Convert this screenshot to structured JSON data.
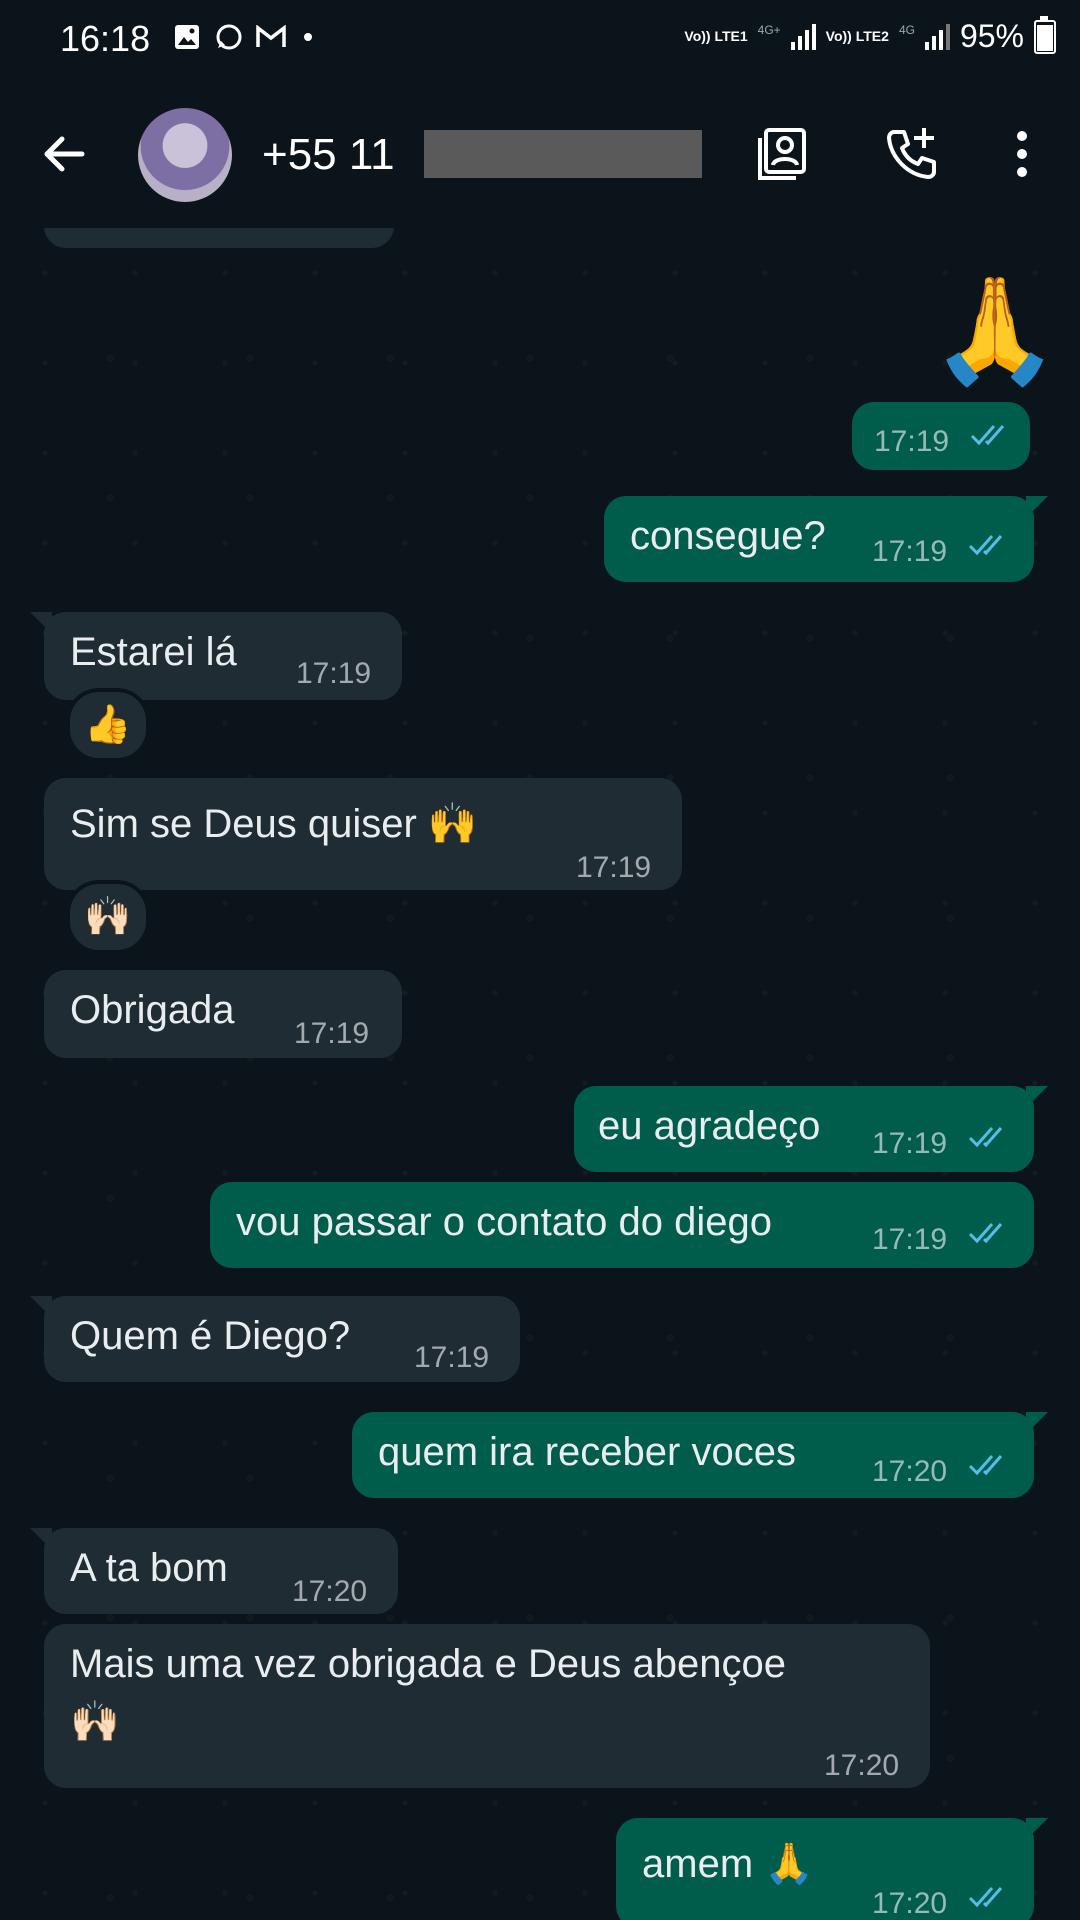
{
  "status_bar": {
    "time": "16:18",
    "sim1_label": "Vo)) LTE1",
    "sim1_net": "4G+",
    "sim2_label": "Vo)) LTE2",
    "sim2_net": "4G",
    "battery": "95%"
  },
  "header": {
    "contact_visible": "+55 11",
    "icons": [
      "back-arrow-icon",
      "contact-card-icon",
      "add-call-icon",
      "more-vertical-icon"
    ]
  },
  "messages": [
    {
      "dir": "out",
      "emoji": "🙏",
      "time": "17:19",
      "status": "read"
    },
    {
      "dir": "out",
      "text": "consegue?",
      "time": "17:19",
      "status": "read"
    },
    {
      "dir": "in",
      "text": "Estarei lá",
      "time": "17:19",
      "reaction": "👍"
    },
    {
      "dir": "in",
      "text": "Sim se Deus quiser 🙌",
      "time": "17:19",
      "reaction": "🙌🏻"
    },
    {
      "dir": "in",
      "text": "Obrigada",
      "time": "17:19"
    },
    {
      "dir": "out",
      "text": "eu agradeço",
      "time": "17:19",
      "status": "read"
    },
    {
      "dir": "out",
      "text": "vou passar o contato do diego",
      "time": "17:19",
      "status": "read"
    },
    {
      "dir": "in",
      "text": "Quem é Diego?",
      "time": "17:19"
    },
    {
      "dir": "out",
      "text": "quem ira receber voces",
      "time": "17:20",
      "status": "read"
    },
    {
      "dir": "in",
      "text": "A ta bom",
      "time": "17:20"
    },
    {
      "dir": "in",
      "text_line1": "Mais uma vez obrigada e Deus abençoe",
      "text_line2": "🙌🏻",
      "time": "17:20"
    },
    {
      "dir": "out",
      "text": "amem 🙏",
      "time": "17:20",
      "status": "read"
    }
  ],
  "colors": {
    "background": "#0b141a",
    "incoming_bubble": "#202c33",
    "outgoing_bubble": "#005c4b",
    "read_ticks": "#53bdeb"
  }
}
